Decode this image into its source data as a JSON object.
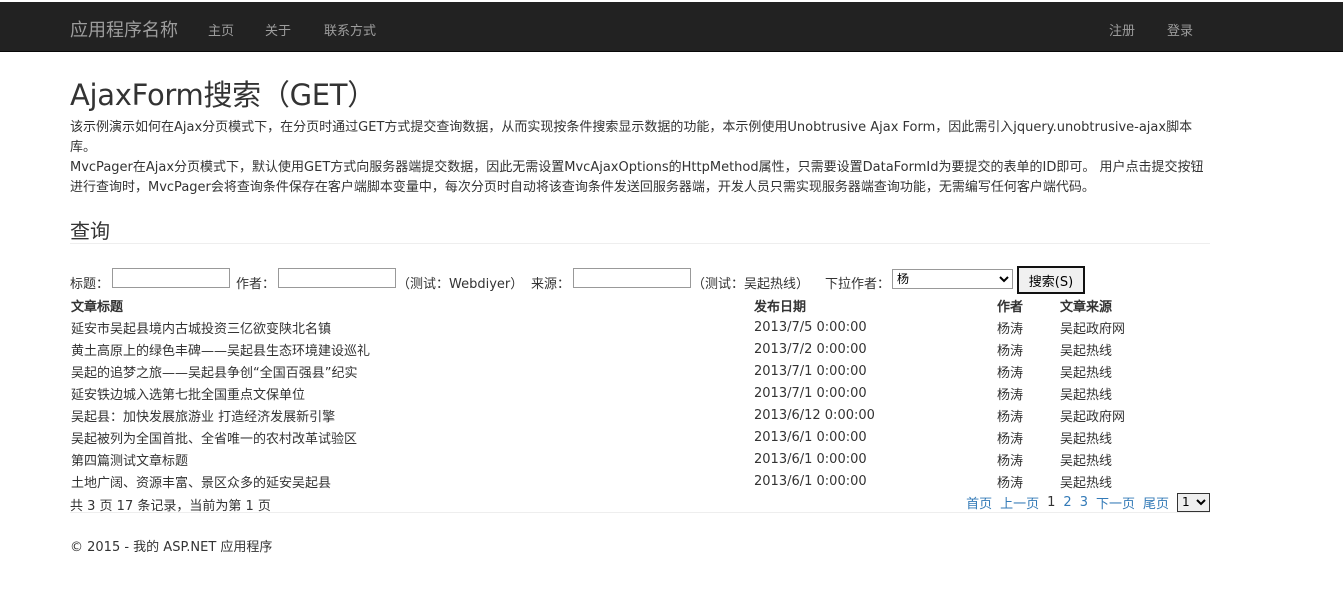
{
  "nav": {
    "brand": "应用程序名称",
    "links": [
      "主页",
      "关于",
      "联系方式"
    ],
    "right_links": [
      "注册",
      "登录"
    ]
  },
  "page": {
    "title": "AjaxForm搜索（GET）",
    "desc1": "该示例演示如何在Ajax分页模式下，在分页时通过GET方式提交查询数据，从而实现按条件搜索显示数据的功能，本示例使用Unobtrusive Ajax Form，因此需引入jquery.unobtrusive-ajax脚本库。",
    "desc2": "MvcPager在Ajax分页模式下，默认使用GET方式向服务器端提交数据，因此无需设置MvcAjaxOptions的HttpMethod属性，只需要设置DataFormId为要提交的表单的ID即可。 用户点击提交按钮进行查询时，MvcPager会将查询条件保存在客户端脚本变量中，每次分页时自动将该查询条件发送回服务器端，开发人员只需实现服务器端查询功能，无需编写任何客户端代码。",
    "section_title": "查询"
  },
  "search": {
    "title_label": "标题：",
    "title_value": "",
    "author_label": "作者：",
    "author_value": "",
    "author_hint": "（测试：Webdiyer）",
    "source_label": "来源：",
    "source_value": "",
    "source_hint": "（测试：吴起热线）",
    "dropdown_label": "下拉作者：",
    "dropdown_value": "杨",
    "button_label": "搜索(S)"
  },
  "table": {
    "headers": [
      "文章标题",
      "发布日期",
      "作者",
      "文章来源"
    ],
    "rows": [
      [
        "延安市吴起县境内古城投资三亿欲变陕北名镇",
        "2013/7/5 0:00:00",
        "杨涛",
        "吴起政府网"
      ],
      [
        "黄土高原上的绿色丰碑——吴起县生态环境建设巡礼",
        "2013/7/2 0:00:00",
        "杨涛",
        "吴起热线"
      ],
      [
        "吴起的追梦之旅——吴起县争创“全国百强县”纪实",
        "2013/7/1 0:00:00",
        "杨涛",
        "吴起热线"
      ],
      [
        "延安铁边城入选第七批全国重点文保单位",
        "2013/7/1 0:00:00",
        "杨涛",
        "吴起热线"
      ],
      [
        "吴起县：加快发展旅游业 打造经济发展新引擎",
        "2013/6/12 0:00:00",
        "杨涛",
        "吴起政府网"
      ],
      [
        "吴起被列为全国首批、全省唯一的农村改革试验区",
        "2013/6/1 0:00:00",
        "杨涛",
        "吴起热线"
      ],
      [
        "第四篇测试文章标题",
        "2013/6/1 0:00:00",
        "杨涛",
        "吴起热线"
      ],
      [
        "土地广阔、资源丰富、景区众多的延安吴起县",
        "2013/6/1 0:00:00",
        "杨涛",
        "吴起热线"
      ]
    ]
  },
  "pager": {
    "summary": "共 3 页 17 条记录，当前为第 1 页",
    "first": "首页",
    "prev": "上一页",
    "current": "1",
    "page2": "2",
    "page3": "3",
    "next": "下一页",
    "last": "尾页",
    "select_value": "1"
  },
  "footer": {
    "text": "© 2015 - 我的 ASP.NET 应用程序"
  }
}
